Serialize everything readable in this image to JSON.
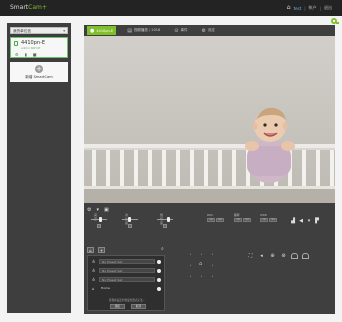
{
  "topbar": {
    "logo_main": "Smart",
    "logo_accent": "Cam",
    "logo_mark": "+",
    "nav": [
      "test",
      "帐户",
      "退出"
    ]
  },
  "sidebar": {
    "dropdown_value": "我的单位信",
    "camera": {
      "name": "4410pn-E",
      "sub": "admin SNH-IP"
    },
    "add_label": "新增 SmartCam"
  },
  "tabs": [
    {
      "label": "4410pn-E",
      "icon": "camera-icon"
    },
    {
      "label": "视频播放 / 2016",
      "icon": "calendar-icon"
    },
    {
      "label": "事件",
      "icon": "play-icon"
    },
    {
      "label": "设定",
      "icon": "gear-icon"
    }
  ],
  "controls": {
    "sliders": [
      "亮度",
      "对比度",
      "饱和度"
    ],
    "modes": [
      {
        "label": "DDC",
        "btns": [
          "ON",
          "OFF"
        ]
      },
      {
        "label": "翻转",
        "btns": [
          "ON",
          "OFF"
        ]
      },
      {
        "label": "WDR",
        "btns": [
          "ON",
          "OFF"
        ]
      }
    ]
  },
  "presets": {
    "items": [
      "No Preset Set",
      "No Preset Set",
      "No Preset Set"
    ],
    "home_label": "Home",
    "note": "您现在设定的预设位置点无法...",
    "btn_save": "确定",
    "btn_cancel": "取消"
  },
  "colors": {
    "accent": "#7fbf2a",
    "panel": "#3f3f3f",
    "sidebar": "#3e3e3e"
  }
}
